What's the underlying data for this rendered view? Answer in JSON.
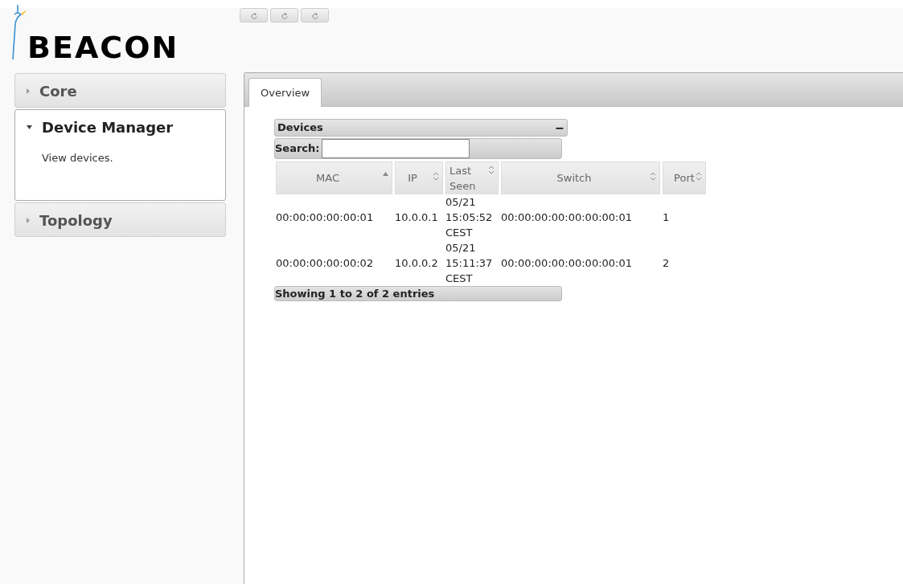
{
  "logo": {
    "text": "BEACON"
  },
  "toolbar_buttons": [
    {
      "kind": "refresh"
    },
    {
      "kind": "refresh"
    },
    {
      "kind": "refresh"
    }
  ],
  "sidebar": {
    "items": [
      {
        "label": "Core",
        "expanded": false
      },
      {
        "label": "Device Manager",
        "expanded": true,
        "description": "View devices."
      },
      {
        "label": "Topology",
        "expanded": false
      }
    ]
  },
  "tabs": [
    {
      "label": "Overview",
      "selected": true
    }
  ],
  "devices_panel": {
    "title": "Devices",
    "collapse_button": "−",
    "search": {
      "label": "Search:"
    },
    "table": {
      "columns": [
        {
          "label": "MAC",
          "sorted": true
        },
        {
          "label": "IP",
          "sorted": false
        },
        {
          "label": "Last Seen",
          "sorted": false
        },
        {
          "label": "Switch",
          "sorted": false
        },
        {
          "label": "Port",
          "sorted": false
        }
      ],
      "rows": [
        [
          "00:00:00:00:00:01",
          "10.0.0.1",
          "05/21 15:05:52 CEST",
          "00:00:00:00:00:00:00:01",
          "1"
        ],
        [
          "00:00:00:00:00:02",
          "10.0.0.2",
          "05/21 15:11:37 CEST",
          "00:00:00:00:00:00:00:01",
          "2"
        ]
      ]
    },
    "info": "Showing 1 to 2 of 2 entries"
  }
}
